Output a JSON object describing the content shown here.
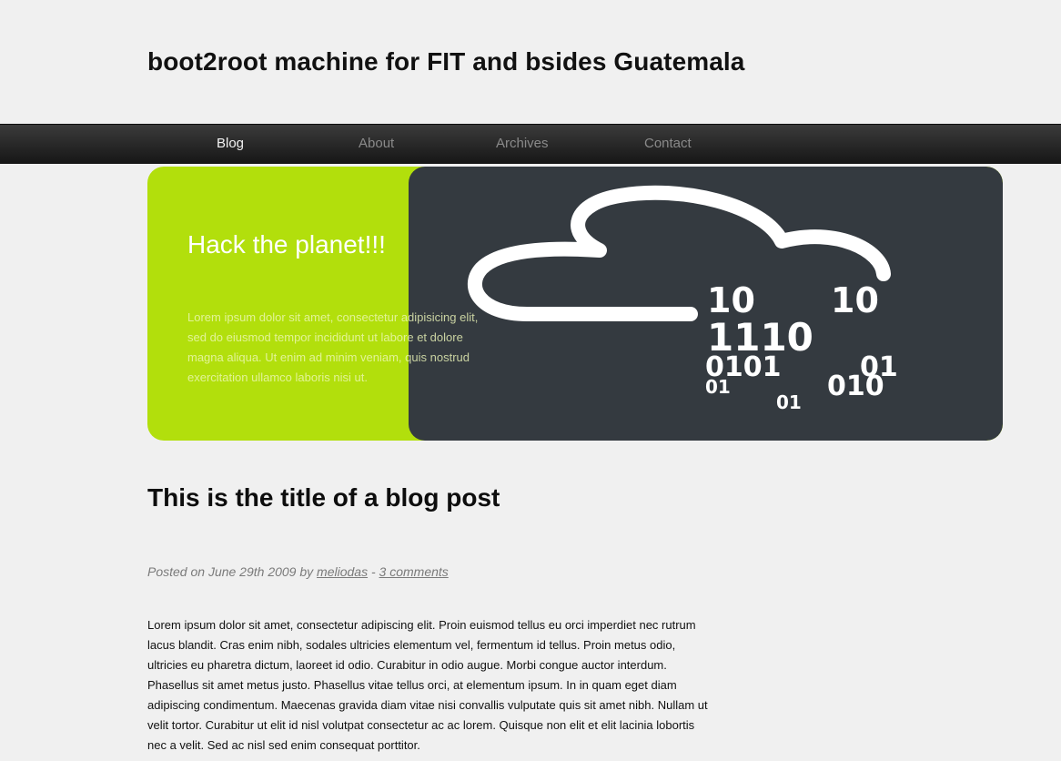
{
  "site": {
    "title": "boot2root machine for FIT and bsides Guatemala"
  },
  "nav": {
    "items": [
      {
        "label": "Blog",
        "active": true
      },
      {
        "label": "About",
        "active": false
      },
      {
        "label": "Archives",
        "active": false
      },
      {
        "label": "Contact",
        "active": false
      }
    ]
  },
  "banner": {
    "heading": "Hack the planet!!!",
    "text": "Lorem ipsum dolor sit amet, consectetur adipisicing elit, sed do eiusmod tempor incididunt ut labore et dolore magna aliqua. Ut enim ad minim veniam, quis nostrud exercitation ullamco laboris nisi ut.",
    "image_icon": "cloud-binary-icon",
    "image_digits": [
      "10",
      "10",
      "1110",
      "0101",
      "01",
      "01",
      "010",
      "01"
    ]
  },
  "post": {
    "title": "This is the title of a blog post",
    "meta_prefix": "Posted on June 29th 2009 by ",
    "author": "meliodas",
    "separator": " - ",
    "comments_link": "3 comments",
    "body": "Lorem ipsum dolor sit amet, consectetur adipiscing elit. Proin euismod tellus eu orci imperdiet nec rutrum lacus blandit. Cras enim nibh, sodales ultricies elementum vel, fermentum id tellus. Proin metus odio, ultricies eu pharetra dictum, laoreet id odio. Curabitur in odio augue. Morbi congue auctor interdum. Phasellus sit amet metus justo. Phasellus vitae tellus orci, at elementum ipsum. In in quam eget diam adipiscing condimentum. Maecenas gravida diam vitae nisi convallis vulputate quis sit amet nibh. Nullam ut velit tortor. Curabitur ut elit id nisl volutpat consectetur ac ac lorem. Quisque non elit et elit lacinia lobortis nec a velit. Sed ac nisl sed enim consequat porttitor."
  },
  "colors": {
    "page_background": "#f0f0f0",
    "nav_background": "#1e1e1e",
    "banner_green": "#b2df0c",
    "banner_dark": "#343a40"
  }
}
